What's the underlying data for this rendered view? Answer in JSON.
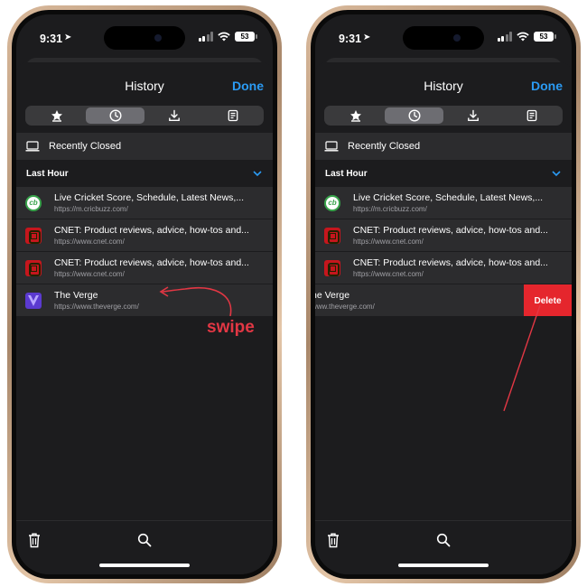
{
  "screens": [
    {
      "status": {
        "time": "9:31",
        "battery": "53"
      },
      "sheet": {
        "title": "History",
        "done_label": "Done"
      },
      "segments": [
        "bookmarks-icon",
        "clock-icon",
        "download-icon",
        "reading-list-icon"
      ],
      "active_segment": "clock-icon",
      "recently_closed": "Recently Closed",
      "section": "Last Hour",
      "rows": [
        {
          "icon": "cricbuzz",
          "icon_text": "cb",
          "title": "Live Cricket Score, Schedule, Latest News,...",
          "url": "https://m.cricbuzz.com/"
        },
        {
          "icon": "cnet",
          "title": "CNET: Product reviews, advice, how-tos and...",
          "url": "https://www.cnet.com/"
        },
        {
          "icon": "cnet",
          "title": "CNET: Product reviews, advice, how-tos and...",
          "url": "https://www.cnet.com/"
        },
        {
          "icon": "verge",
          "title": "The Verge",
          "url": "https://www.theverge.com/"
        }
      ]
    },
    {
      "status": {
        "time": "9:31",
        "battery": "53"
      },
      "sheet": {
        "title": "History",
        "done_label": "Done"
      },
      "segments": [
        "bookmarks-icon",
        "clock-icon",
        "download-icon",
        "reading-list-icon"
      ],
      "active_segment": "clock-icon",
      "recently_closed": "Recently Closed",
      "section": "Last Hour",
      "rows": [
        {
          "icon": "cricbuzz",
          "icon_text": "cb",
          "title": "Live Cricket Score, Schedule, Latest News,...",
          "url": "https://m.cricbuzz.com/"
        },
        {
          "icon": "cnet",
          "title": "CNET: Product reviews, advice, how-tos and...",
          "url": "https://www.cnet.com/"
        },
        {
          "icon": "cnet",
          "title": "CNET: Product reviews, advice, how-tos and...",
          "url": "https://www.cnet.com/"
        },
        {
          "icon": "verge",
          "title": "he Verge",
          "url": "www.theverge.com/"
        }
      ],
      "delete_label": "Delete"
    }
  ],
  "annotation": {
    "swipe_label": "swipe",
    "color": "#e23744"
  },
  "colors": {
    "accent": "#2b9bf4",
    "delete": "#e5262d",
    "background": "#1c1c1e",
    "row": "#2c2c2e"
  }
}
